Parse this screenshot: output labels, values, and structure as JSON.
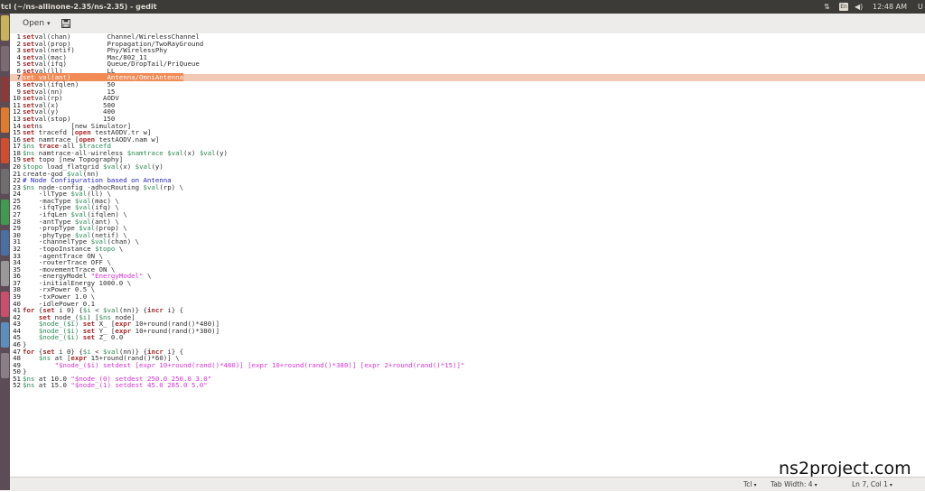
{
  "window": {
    "title": "tcl (~/ns-allinone-2.35/ns-2.35) - gedit"
  },
  "indicators": {
    "keyboard": "En",
    "volume": "◀)",
    "time": "12:48 AM",
    "user": "U",
    "network": "⇅"
  },
  "toolbar": {
    "open_label": "Open",
    "save_icon": "save-icon"
  },
  "status": {
    "language": "Tcl",
    "tab_width": "Tab Width: 4",
    "position": "Ln 7, Col 1"
  },
  "watermark": "ns2project.com",
  "colors": {
    "keyword": "#a52a2a",
    "variable": "#2e8b57",
    "string": "#d633d6",
    "comment": "#1f1fbf",
    "selection": "#f28a55",
    "current_line": "#f1c9b4"
  },
  "lines": [
    {
      "n": "1",
      "segs": [
        [
          "kw",
          "set"
        ],
        [
          "",
          "val(chan)         Channel/WirelessChannel"
        ]
      ]
    },
    {
      "n": "2",
      "segs": [
        [
          "kw",
          "set"
        ],
        [
          "",
          "val(prop)         Propagation/TwoRayGround"
        ]
      ]
    },
    {
      "n": "3",
      "segs": [
        [
          "kw",
          "set"
        ],
        [
          "",
          "val(netif)        Phy/WirelessPhy"
        ]
      ]
    },
    {
      "n": "4",
      "segs": [
        [
          "kw",
          "set"
        ],
        [
          "",
          "val(mac)          Mac/802_11"
        ]
      ]
    },
    {
      "n": "5",
      "segs": [
        [
          "kw",
          "set"
        ],
        [
          "",
          "val(ifq)          Queue/DropTail/PriQueue"
        ]
      ]
    },
    {
      "n": "6",
      "segs": [
        [
          "kw",
          "set"
        ],
        [
          "",
          "val(ll)           LL"
        ]
      ]
    },
    {
      "n": "7",
      "current": true,
      "segs": [
        [
          "sel",
          "set val(ant)         Antenna/OmniAntenna"
        ]
      ]
    },
    {
      "n": "8",
      "segs": [
        [
          "kw",
          "set"
        ],
        [
          "",
          "val(ifqlen)       50"
        ]
      ]
    },
    {
      "n": "9",
      "segs": [
        [
          "kw",
          "set"
        ],
        [
          "",
          "val(nn)           15"
        ]
      ]
    },
    {
      "n": "10",
      "segs": [
        [
          "kw",
          "set"
        ],
        [
          "",
          "val(rp)          AODV"
        ]
      ]
    },
    {
      "n": "11",
      "segs": [
        [
          "kw",
          "set"
        ],
        [
          "",
          "val(x)           500"
        ]
      ]
    },
    {
      "n": "12",
      "segs": [
        [
          "kw",
          "set"
        ],
        [
          "",
          "val(y)           400"
        ]
      ]
    },
    {
      "n": "13",
      "segs": [
        [
          "kw",
          "set"
        ],
        [
          "",
          "val(stop)        150"
        ]
      ]
    },
    {
      "n": "14",
      "segs": [
        [
          "kw",
          "set"
        ],
        [
          "",
          "ns       [new Simulator]"
        ]
      ]
    },
    {
      "n": "15",
      "segs": [
        [
          "kw",
          "set"
        ],
        [
          "",
          " tracefd ["
        ],
        [
          "kw",
          "open"
        ],
        [
          "",
          " testAODV.tr w]"
        ]
      ]
    },
    {
      "n": "16",
      "segs": [
        [
          "kw",
          "set"
        ],
        [
          "",
          " namtrace ["
        ],
        [
          "kw",
          "open"
        ],
        [
          "",
          " testAODV.nam w]"
        ]
      ]
    },
    {
      "n": "17",
      "segs": [
        [
          "var",
          "$ns"
        ],
        [
          "",
          " "
        ],
        [
          "kw",
          "trace"
        ],
        [
          "",
          "-all "
        ],
        [
          "var",
          "$tracefd"
        ]
      ]
    },
    {
      "n": "18",
      "segs": [
        [
          "var",
          "$ns"
        ],
        [
          "",
          " namtrace-all-wireless "
        ],
        [
          "var",
          "$namtrace"
        ],
        [
          "",
          " "
        ],
        [
          "var",
          "$val"
        ],
        [
          "",
          "(x) "
        ],
        [
          "var",
          "$val"
        ],
        [
          "",
          "(y)"
        ]
      ]
    },
    {
      "n": "19",
      "segs": [
        [
          "kw",
          "set"
        ],
        [
          "",
          " topo [new Topography]"
        ]
      ]
    },
    {
      "n": "20",
      "segs": [
        [
          "var",
          "$topo"
        ],
        [
          "",
          " load_flatgrid "
        ],
        [
          "var",
          "$val"
        ],
        [
          "",
          "(x) "
        ],
        [
          "var",
          "$val"
        ],
        [
          "",
          "(y)"
        ]
      ]
    },
    {
      "n": "21",
      "segs": [
        [
          "",
          "create-god "
        ],
        [
          "var",
          "$val"
        ],
        [
          "",
          "(nn)"
        ]
      ]
    },
    {
      "n": "22",
      "segs": [
        [
          "cmt",
          "# Node Configuration based on Antenna"
        ]
      ]
    },
    {
      "n": "23",
      "segs": [
        [
          "var",
          "$ns"
        ],
        [
          "",
          " node-config -adhocRouting "
        ],
        [
          "var",
          "$val"
        ],
        [
          "",
          "(rp) \\"
        ]
      ]
    },
    {
      "n": "24",
      "segs": [
        [
          "",
          "    -llType "
        ],
        [
          "var",
          "$val"
        ],
        [
          "",
          "(ll) \\"
        ]
      ]
    },
    {
      "n": "25",
      "segs": [
        [
          "",
          "    -macType "
        ],
        [
          "var",
          "$val"
        ],
        [
          "",
          "(mac) \\"
        ]
      ]
    },
    {
      "n": "26",
      "segs": [
        [
          "",
          "    -ifqType "
        ],
        [
          "var",
          "$val"
        ],
        [
          "",
          "(ifq) \\"
        ]
      ]
    },
    {
      "n": "27",
      "segs": [
        [
          "",
          "    -ifqLen "
        ],
        [
          "var",
          "$val"
        ],
        [
          "",
          "(ifqlen) \\"
        ]
      ]
    },
    {
      "n": "28",
      "segs": [
        [
          "",
          "    -antType "
        ],
        [
          "var",
          "$val"
        ],
        [
          "",
          "(ant) \\"
        ]
      ]
    },
    {
      "n": "29",
      "segs": [
        [
          "",
          "    -propType "
        ],
        [
          "var",
          "$val"
        ],
        [
          "",
          "(prop) \\"
        ]
      ]
    },
    {
      "n": "30",
      "segs": [
        [
          "",
          "    -phyType "
        ],
        [
          "var",
          "$val"
        ],
        [
          "",
          "(netif) \\"
        ]
      ]
    },
    {
      "n": "31",
      "segs": [
        [
          "",
          "    -channelType "
        ],
        [
          "var",
          "$val"
        ],
        [
          "",
          "(chan) \\"
        ]
      ]
    },
    {
      "n": "32",
      "segs": [
        [
          "",
          "    -topoInstance "
        ],
        [
          "var",
          "$topo"
        ],
        [
          "",
          " \\"
        ]
      ]
    },
    {
      "n": "33",
      "segs": [
        [
          "",
          "    -agentTrace ON \\"
        ]
      ]
    },
    {
      "n": "34",
      "segs": [
        [
          "",
          "    -routerTrace OFF \\"
        ]
      ]
    },
    {
      "n": "35",
      "segs": [
        [
          "",
          "    -movementTrace ON \\"
        ]
      ]
    },
    {
      "n": "36",
      "segs": [
        [
          "",
          "    -energyModel "
        ],
        [
          "str",
          "\"EnergyModel\""
        ],
        [
          "",
          " \\"
        ]
      ]
    },
    {
      "n": "37",
      "segs": [
        [
          "",
          "    -initialEnergy 1000.0 \\"
        ]
      ]
    },
    {
      "n": "38",
      "segs": [
        [
          "",
          "    -rxPower 0.5 \\"
        ]
      ]
    },
    {
      "n": "39",
      "segs": [
        [
          "",
          "    -txPower 1.0 \\"
        ]
      ]
    },
    {
      "n": "40",
      "segs": [
        [
          "",
          "    -idlePower 0.1"
        ]
      ]
    },
    {
      "n": "41",
      "segs": [
        [
          "kw",
          "for"
        ],
        [
          "",
          " {"
        ],
        [
          "kw",
          "set"
        ],
        [
          "",
          " i 0} {"
        ],
        [
          "var",
          "$i"
        ],
        [
          "",
          " < "
        ],
        [
          "var",
          "$val"
        ],
        [
          "",
          "(nn)} {"
        ],
        [
          "kw",
          "incr"
        ],
        [
          "",
          " i} {"
        ]
      ]
    },
    {
      "n": "42",
      "segs": [
        [
          "",
          "    "
        ],
        [
          "kw",
          "set"
        ],
        [
          "",
          " node_("
        ],
        [
          "var",
          "$i"
        ],
        [
          "",
          ") ["
        ],
        [
          "var",
          "$ns"
        ],
        [
          "",
          " node]"
        ]
      ]
    },
    {
      "n": "43",
      "segs": [
        [
          "",
          "    "
        ],
        [
          "var",
          "$node_($i)"
        ],
        [
          "",
          " "
        ],
        [
          "kw",
          "set"
        ],
        [
          "",
          " X_ ["
        ],
        [
          "kw",
          "expr"
        ],
        [
          "",
          " 10+round(rand()*480)]"
        ]
      ]
    },
    {
      "n": "44",
      "segs": [
        [
          "",
          "    "
        ],
        [
          "var",
          "$node_($i)"
        ],
        [
          "",
          " "
        ],
        [
          "kw",
          "set"
        ],
        [
          "",
          " Y_ ["
        ],
        [
          "kw",
          "expr"
        ],
        [
          "",
          " 10+round(rand()*380)]"
        ]
      ]
    },
    {
      "n": "45",
      "segs": [
        [
          "",
          "    "
        ],
        [
          "var",
          "$node_($i)"
        ],
        [
          "",
          " "
        ],
        [
          "kw",
          "set"
        ],
        [
          "",
          " Z_ 0.0"
        ]
      ]
    },
    {
      "n": "46",
      "segs": [
        [
          "",
          "}"
        ]
      ]
    },
    {
      "n": "47",
      "segs": [
        [
          "kw",
          "for"
        ],
        [
          "",
          " {"
        ],
        [
          "kw",
          "set"
        ],
        [
          "",
          " i 0} {"
        ],
        [
          "var",
          "$i"
        ],
        [
          "",
          " < "
        ],
        [
          "var",
          "$val"
        ],
        [
          "",
          "(nn)} {"
        ],
        [
          "kw",
          "incr"
        ],
        [
          "",
          " i} {"
        ]
      ]
    },
    {
      "n": "48",
      "segs": [
        [
          "",
          "    "
        ],
        [
          "var",
          "$ns"
        ],
        [
          "",
          " at ["
        ],
        [
          "kw",
          "expr"
        ],
        [
          "",
          " 15+round(rand()*60)] \\"
        ]
      ]
    },
    {
      "n": "49",
      "segs": [
        [
          "str",
          "        \"$node_($i) setdest [expr 10+round(rand()*480)] [expr 10+round(rand()*380)] [expr 2+round(rand()*15)]\""
        ]
      ]
    },
    {
      "n": "50",
      "segs": [
        [
          "",
          "}"
        ]
      ]
    },
    {
      "n": "51",
      "segs": [
        [
          "var",
          "$ns"
        ],
        [
          "",
          " at 10.0 "
        ],
        [
          "str",
          "\"$node_(0) setdest 250.0 250.0 3.0\""
        ]
      ]
    },
    {
      "n": "52",
      "segs": [
        [
          "var",
          "$ns"
        ],
        [
          "",
          " at 15.0 "
        ],
        [
          "str",
          "\"$node_(1) setdest 45.0 285.0 5.0\""
        ]
      ]
    }
  ]
}
